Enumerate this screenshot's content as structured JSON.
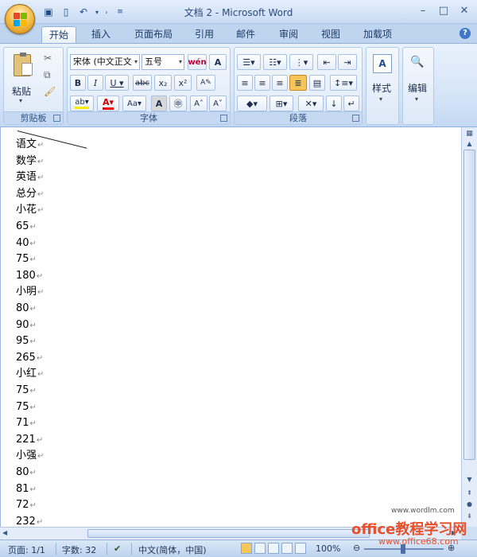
{
  "window": {
    "title": "文档 2 - Microsoft Word"
  },
  "tabs": [
    "开始",
    "插入",
    "页面布局",
    "引用",
    "邮件",
    "审阅",
    "视图",
    "加载项"
  ],
  "ribbon": {
    "clipboard": {
      "paste_label": "粘贴",
      "title": "剪贴板"
    },
    "font": {
      "font_name": "宋体 (中文正文",
      "font_size": "五号",
      "title": "字体"
    },
    "paragraph": {
      "title": "段落"
    },
    "styles": {
      "label": "样式"
    },
    "editing": {
      "label": "编辑"
    }
  },
  "document": {
    "lines": [
      "语文",
      "数学",
      "英语",
      "总分",
      "小花",
      "65",
      "40",
      "75",
      "180",
      "小明",
      "80",
      "90",
      "95",
      "265",
      "小红",
      "75",
      "75",
      "71",
      "221",
      "小强",
      "80",
      "81",
      "72",
      "232"
    ],
    "mark": "↵"
  },
  "statusbar": {
    "page": "页面: 1/1",
    "words": "字数: 32",
    "language": "中文(简体，中国)",
    "zoom": "100%"
  },
  "watermark": {
    "main": "office教程学习网",
    "url1": "www.wordlm.com",
    "url2": "www.office68.com"
  }
}
